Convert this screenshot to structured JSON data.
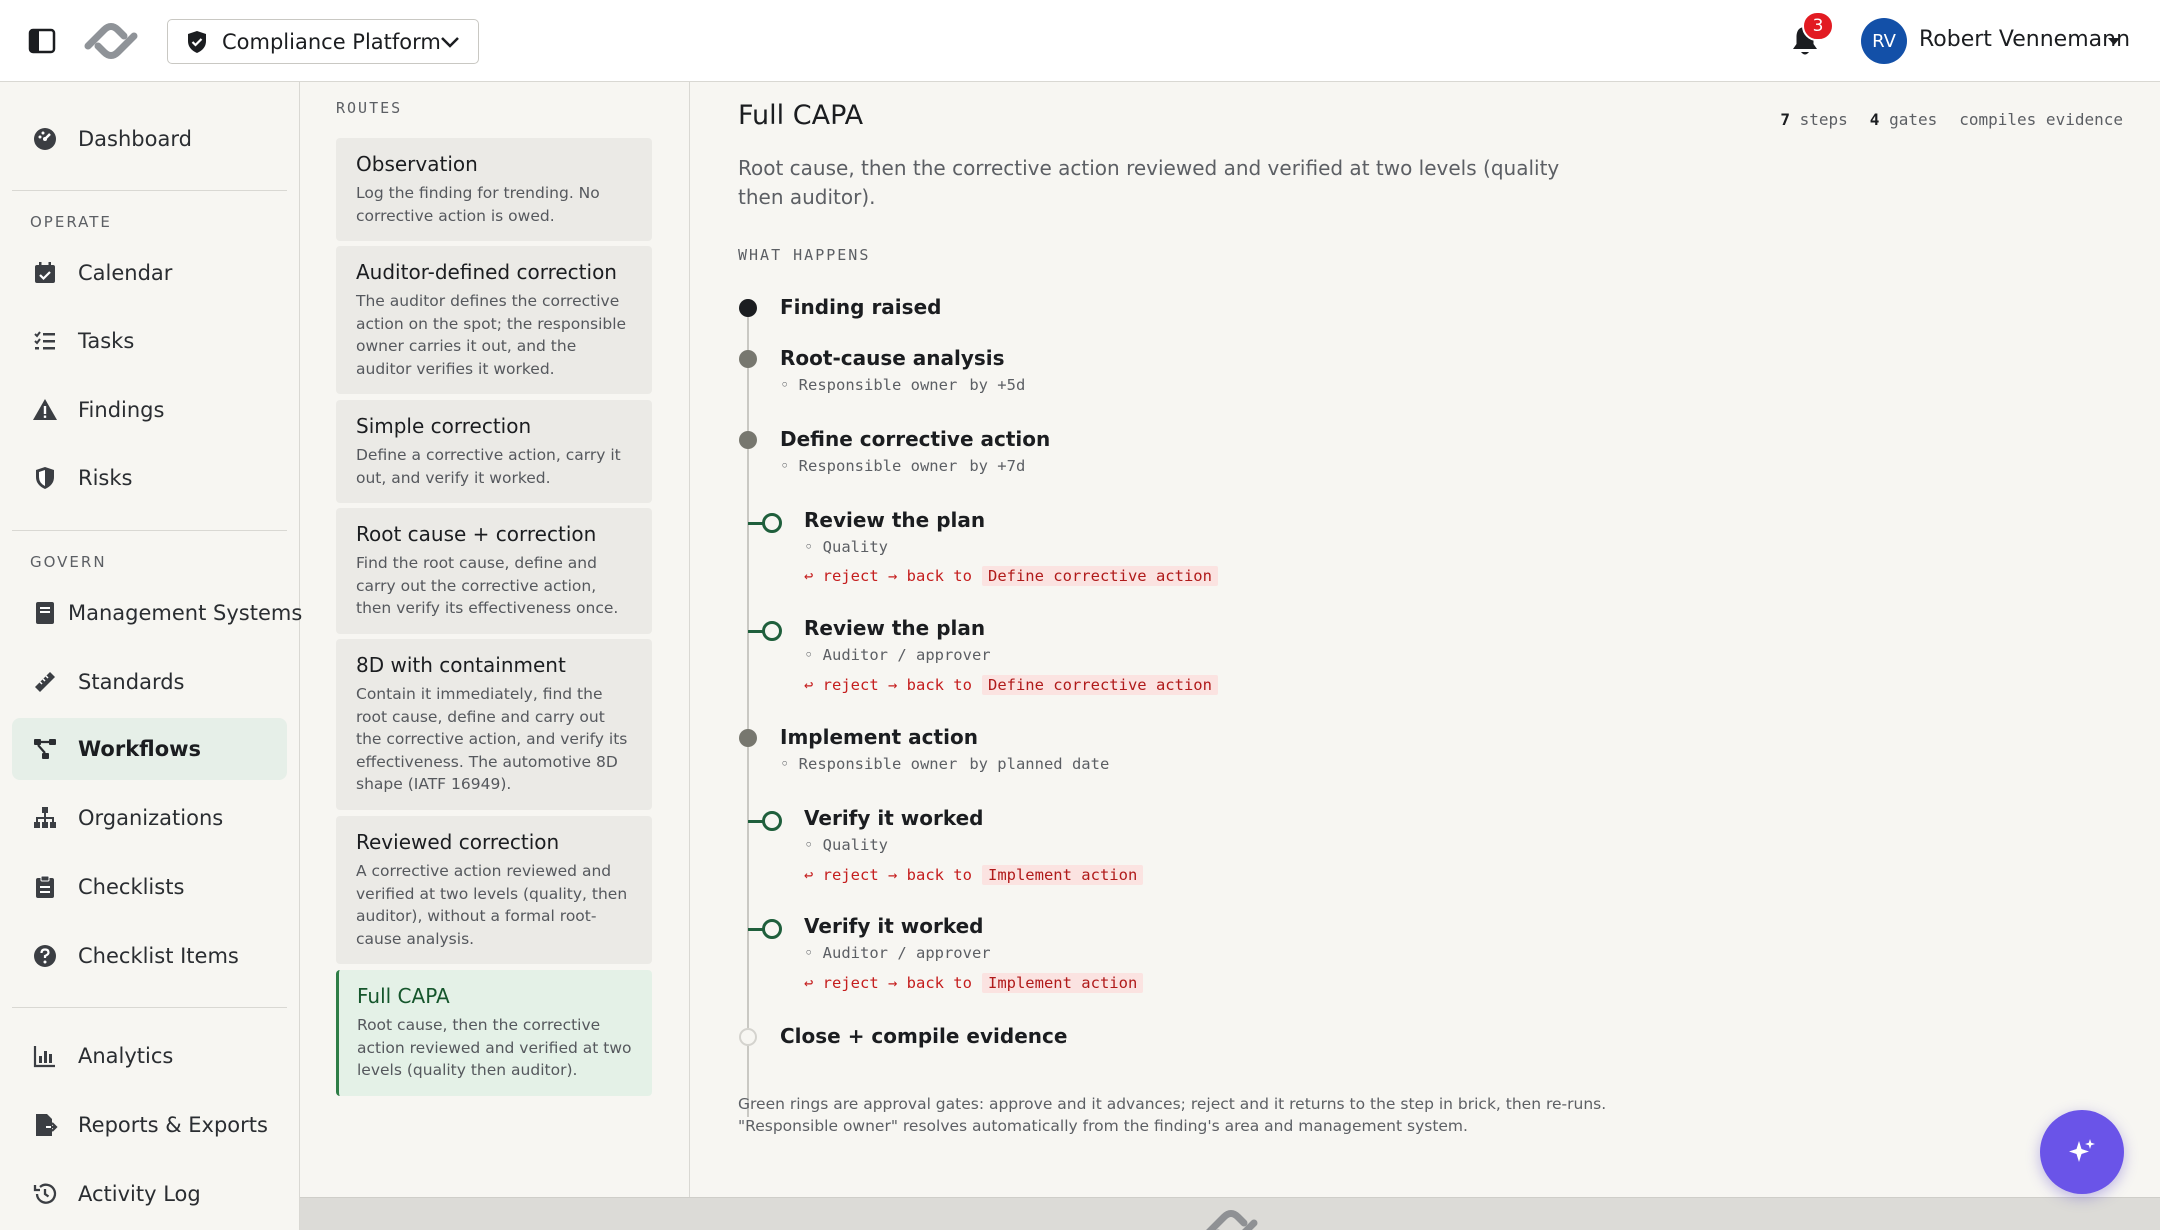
{
  "header": {
    "platform": "Compliance Platform",
    "notifications": "3",
    "user_initials": "RV",
    "user_name": "Robert Vennemann"
  },
  "sidebar": {
    "top": [
      {
        "label": "Dashboard",
        "icon": "dashboard-icon"
      }
    ],
    "sections": [
      {
        "title": "OPERATE",
        "items": [
          {
            "label": "Calendar",
            "icon": "calendar-icon"
          },
          {
            "label": "Tasks",
            "icon": "tasks-icon"
          },
          {
            "label": "Findings",
            "icon": "warning-icon"
          },
          {
            "label": "Risks",
            "icon": "shield-icon"
          }
        ]
      },
      {
        "title": "GOVERN",
        "items": [
          {
            "label": "Management Systems",
            "icon": "book-icon"
          },
          {
            "label": "Standards",
            "icon": "ruler-icon"
          },
          {
            "label": "Workflows",
            "icon": "workflow-icon",
            "active": true
          },
          {
            "label": "Organizations",
            "icon": "org-icon"
          },
          {
            "label": "Checklists",
            "icon": "clipboard-icon"
          },
          {
            "label": "Checklist Items",
            "icon": "question-icon"
          }
        ]
      },
      {
        "title": "",
        "items": [
          {
            "label": "Analytics",
            "icon": "chart-icon"
          },
          {
            "label": "Reports & Exports",
            "icon": "export-icon"
          },
          {
            "label": "Activity Log",
            "icon": "history-icon"
          }
        ]
      }
    ]
  },
  "routes": {
    "title": "ROUTES",
    "items": [
      {
        "title": "Observation",
        "desc": "Log the finding for trending. No corrective action is owed."
      },
      {
        "title": "Auditor-defined correction",
        "desc": "The auditor defines the corrective action on the spot; the responsible owner carries it out, and the auditor verifies it worked."
      },
      {
        "title": "Simple correction",
        "desc": "Define a corrective action, carry it out, and verify it worked."
      },
      {
        "title": "Root cause + correction",
        "desc": "Find the root cause, define and carry out the corrective action, then verify its effectiveness once."
      },
      {
        "title": "8D with containment",
        "desc": "Contain it immediately, find the root cause, define and carry out the corrective action, and verify its effectiveness. The automotive 8D shape (IATF 16949)."
      },
      {
        "title": "Reviewed correction",
        "desc": "A corrective action reviewed and verified at two levels (quality, then auditor), without a formal root-cause analysis."
      },
      {
        "title": "Full CAPA",
        "desc": "Root cause, then the corrective action reviewed and verified at two levels (quality then auditor).",
        "active": true
      }
    ]
  },
  "main": {
    "title": "Full CAPA",
    "stats": {
      "steps_count": "7",
      "steps_label": "steps",
      "gates_count": "4",
      "gates_label": "gates",
      "evidence": "compiles evidence"
    },
    "description": "Root cause, then the corrective action reviewed and verified at two levels (quality then auditor).",
    "what_happens": "WHAT HAPPENS",
    "timeline": [
      {
        "kind": "start",
        "name": "Finding raised"
      },
      {
        "kind": "step",
        "name": "Root-cause analysis",
        "owner": "◦ Responsible owner",
        "when": "by +5d"
      },
      {
        "kind": "step",
        "name": "Define corrective action",
        "owner": "◦ Responsible owner",
        "when": "by +7d"
      },
      {
        "kind": "gate",
        "name": "Review the plan",
        "owner": "◦ Quality",
        "reject": "↩ reject → back to",
        "target": "Define corrective action"
      },
      {
        "kind": "gate",
        "name": "Review the plan",
        "owner": "◦ Auditor / approver",
        "reject": "↩ reject → back to",
        "target": "Define corrective action"
      },
      {
        "kind": "step",
        "name": "Implement action",
        "owner": "◦ Responsible owner",
        "when": "by planned date"
      },
      {
        "kind": "gate",
        "name": "Verify it worked",
        "owner": "◦ Quality",
        "reject": "↩ reject → back to",
        "target": "Implement action"
      },
      {
        "kind": "gate",
        "name": "Verify it worked",
        "owner": "◦ Auditor / approver",
        "reject": "↩ reject → back to",
        "target": "Implement action"
      },
      {
        "kind": "end",
        "name": "Close + compile evidence"
      }
    ],
    "footnote_1": "Green rings are approval gates: approve and it advances; reject and it returns to the step in brick, then re-runs.",
    "footnote_2": "\"Responsible owner\" resolves automatically from the finding's area and management system."
  },
  "colors": {
    "accent_green": "#1f5f3c",
    "active_bg": "#e6efe8",
    "reject_red": "#c51e1e",
    "fab": "#6a54e8",
    "avatar": "#1350a8",
    "badge": "#e21b22"
  }
}
